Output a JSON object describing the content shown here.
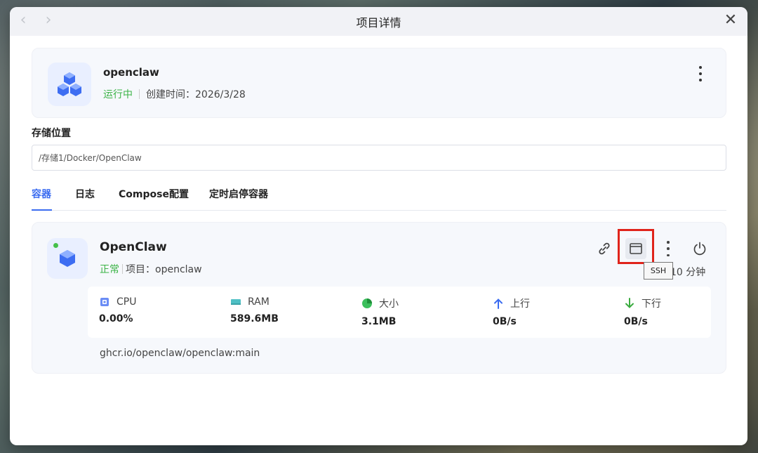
{
  "window": {
    "title": "项目详情"
  },
  "project": {
    "name": "openclaw",
    "status": "运行中",
    "created": "创建时间：2026/3/28"
  },
  "storage": {
    "label": "存储位置",
    "value": "/存储1/Docker/OpenClaw"
  },
  "tabs": [
    {
      "label": "容器",
      "active": true
    },
    {
      "label": "日志",
      "active": false
    },
    {
      "label": "Compose配置",
      "active": false
    },
    {
      "label": "定时启停容器",
      "active": false
    }
  ],
  "container": {
    "name": "OpenClaw",
    "status": "正常",
    "project": "项目：openclaw",
    "uptime": "10 分钟",
    "tooltip": "SSH",
    "image": "ghcr.io/openclaw/openclaw:main",
    "stats": [
      {
        "label": "CPU",
        "value": "0.00%",
        "icon": "cpu-icon"
      },
      {
        "label": "RAM",
        "value": "589.6MB",
        "icon": "ram-icon"
      },
      {
        "label": "大小",
        "value": "3.1MB",
        "icon": "pie-icon"
      },
      {
        "label": "上行",
        "value": "0B/s",
        "icon": "arrow-up-icon"
      },
      {
        "label": "下行",
        "value": "0B/s",
        "icon": "arrow-down-icon"
      }
    ]
  },
  "colors": {
    "accent": "#3b6cf0",
    "success": "#3bb346",
    "highlight": "#e0241b",
    "download": "#3aab3f"
  }
}
